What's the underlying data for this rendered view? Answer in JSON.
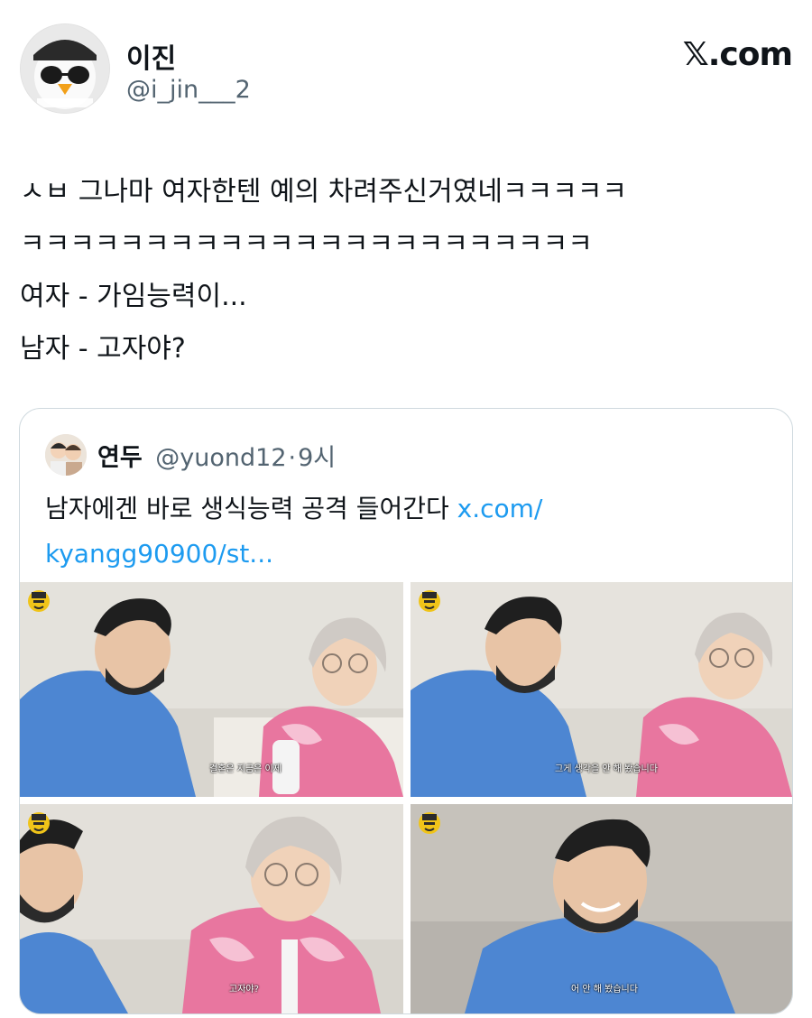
{
  "author": {
    "display_name": "이진",
    "handle": "@i_jin___2"
  },
  "brand": "𝕏.com",
  "tweet": {
    "lines": [
      "ㅅㅂ 그나마 여자한텐 예의 차려주신거였네ㅋㅋㅋㅋㅋ",
      "ㅋㅋㅋㅋㅋㅋㅋㅋㅋㅋㅋㅋㅋㅋㅋㅋㅋㅋㅋㅋㅋㅋㅋ",
      "여자 - 가임능력이...",
      "남자 - 고자야?"
    ]
  },
  "quoted": {
    "display_name": "연두",
    "handle": "@yuond12",
    "separator": "·",
    "time": "9시",
    "text": "남자에겐 바로 생식능력 공격 들어간다 ",
    "link_line1": "x.com/",
    "link_line2": "kyangg90900/st..."
  },
  "media": {
    "subtitles": [
      "결혼은 지금은 이제",
      "그게 생각을 안 해 봤습니다",
      "고자야?",
      "어 안 해 봤습니다"
    ]
  },
  "colors": {
    "link": "#1d9bf0",
    "muted": "#536471",
    "border": "#cfd9de",
    "hoodie_blue": "#4d86d2",
    "jacket_pink": "#e8769f"
  }
}
